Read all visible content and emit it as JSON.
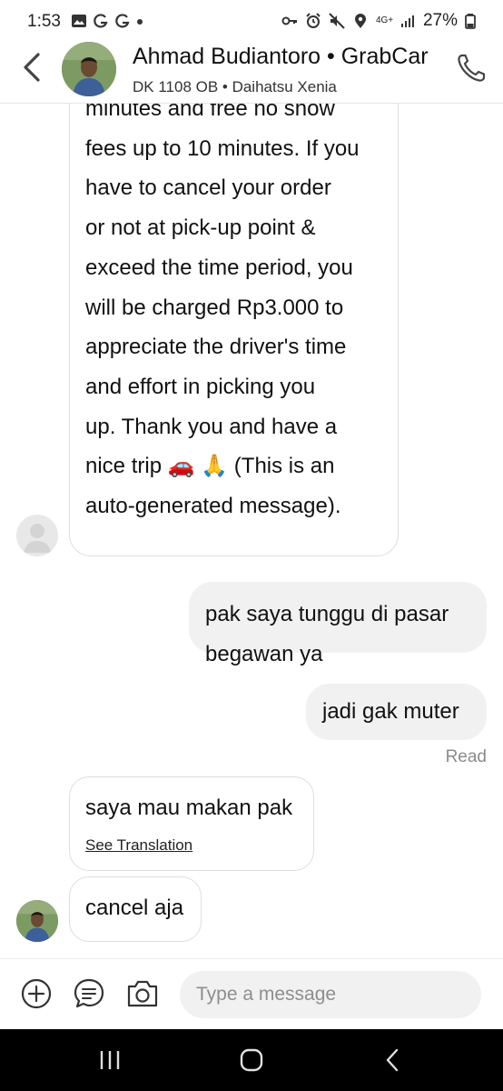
{
  "status_bar": {
    "time": "1:53",
    "network_label": "4G+",
    "battery": "27%"
  },
  "header": {
    "contact_name": "Ahmad Budiantoro • GrabCar",
    "vehicle_info": "DK 1108 OB • Daihatsu Xenia"
  },
  "messages": {
    "long_text": "minutes and free no show\nfees up to 10 minutes. If you\nhave to cancel your order\nor not at pick-up point &\nexceed the time period, you\nwill be charged Rp3.000 to\nappreciate the driver's time\nand effort in picking you\nup. Thank you and have a\nnice trip 🚗 🙏 (This is an\nauto-generated message).",
    "out_1": "pak saya tunggu di pasar\nbegawan ya",
    "out_2": "jadi gak muter",
    "read_label": "Read",
    "in_2": "saya mau makan pak",
    "see_translation": "See Translation",
    "in_3": "cancel aja"
  },
  "composer": {
    "placeholder": "Type a message"
  },
  "icons": {
    "back": "chevron-left-icon",
    "call": "phone-icon",
    "add": "plus-circle-icon",
    "quick_reply": "chat-bubble-icon",
    "camera": "camera-icon"
  },
  "colors": {
    "bubble_out": "#f1f1f1",
    "bubble_in_border": "#dedede",
    "read": "#8b8b8b"
  }
}
